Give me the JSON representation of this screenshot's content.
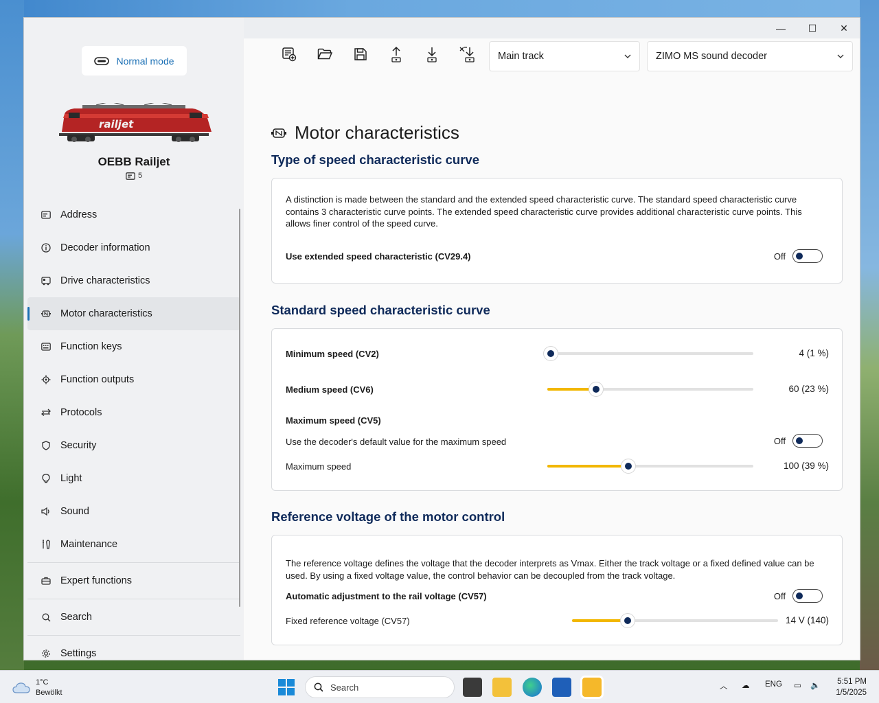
{
  "window": {
    "controls": {
      "minimize": "—",
      "maximize": "☐",
      "close": "✕"
    }
  },
  "sidebar": {
    "mode_label": "Normal mode",
    "loco_name": "OEBB Railjet",
    "loco_address": "5",
    "loco_image_text": "railjet",
    "items": [
      {
        "label": "Address",
        "icon": "address-card-icon"
      },
      {
        "label": "Decoder information",
        "icon": "info-icon"
      },
      {
        "label": "Drive characteristics",
        "icon": "drive-icon"
      },
      {
        "label": "Motor characteristics",
        "icon": "motor-icon",
        "active": true
      },
      {
        "label": "Function keys",
        "icon": "keyboard-icon"
      },
      {
        "label": "Function outputs",
        "icon": "outputs-icon"
      },
      {
        "label": "Protocols",
        "icon": "arrows-icon"
      },
      {
        "label": "Security",
        "icon": "shield-icon"
      },
      {
        "label": "Light",
        "icon": "bulb-icon"
      },
      {
        "label": "Sound",
        "icon": "speaker-icon"
      },
      {
        "label": "Maintenance",
        "icon": "tools-icon"
      },
      {
        "label": "Expert functions",
        "icon": "briefcase-icon"
      },
      {
        "label": "Search",
        "icon": "search-icon"
      },
      {
        "label": "Settings",
        "icon": "gear-icon"
      }
    ]
  },
  "toolbar": {
    "track_select": "Main track",
    "decoder_select": "ZIMO MS sound decoder"
  },
  "page": {
    "title": "Motor characteristics",
    "sections": {
      "type_curve": {
        "title": "Type of speed characteristic curve",
        "description": "A distinction is made between the standard and the extended speed characteristic curve. The standard speed characteristic curve contains 3 characteristic curve points. The extended speed characteristic curve provides additional characteristic curve points. This allows finer control of the speed curve.",
        "extended_label": "Use extended speed characteristic (CV29.4)",
        "extended_state": "Off"
      },
      "standard_curve": {
        "title": "Standard speed characteristic curve",
        "min_label": "Minimum speed (CV2)",
        "min_value": "4 (1 %)",
        "min_fraction": 0.016,
        "med_label": "Medium speed (CV6)",
        "med_value": "60 (23 %)",
        "med_fraction": 0.235,
        "max_heading": "Maximum speed (CV5)",
        "default_label": "Use the decoder's default value for the maximum speed",
        "default_state": "Off",
        "max_label": "Maximum speed",
        "max_value": "100 (39 %)",
        "max_fraction": 0.392
      },
      "reference_voltage": {
        "title": "Reference voltage of the motor control",
        "description": "The reference voltage defines the voltage that the decoder interprets as Vmax. Either the track voltage or a fixed defined value can be used. By using a fixed voltage value, the control behavior can be decoupled from the track voltage.",
        "auto_label": "Automatic adjustment to the rail voltage (CV57)",
        "auto_state": "Off",
        "fixed_label": "Fixed reference voltage (CV57)",
        "fixed_value": "14 V (140)",
        "fixed_fraction": 0.27
      }
    }
  },
  "taskbar": {
    "temperature": "1°C",
    "weather": "Bewölkt",
    "search_placeholder": "Search",
    "language": "ENG",
    "time": "5:51 PM",
    "date": "1/5/2025"
  },
  "colors": {
    "accent": "#1a6fb5",
    "heading": "#0f2a5a",
    "slider_fill": "#f2b700"
  }
}
